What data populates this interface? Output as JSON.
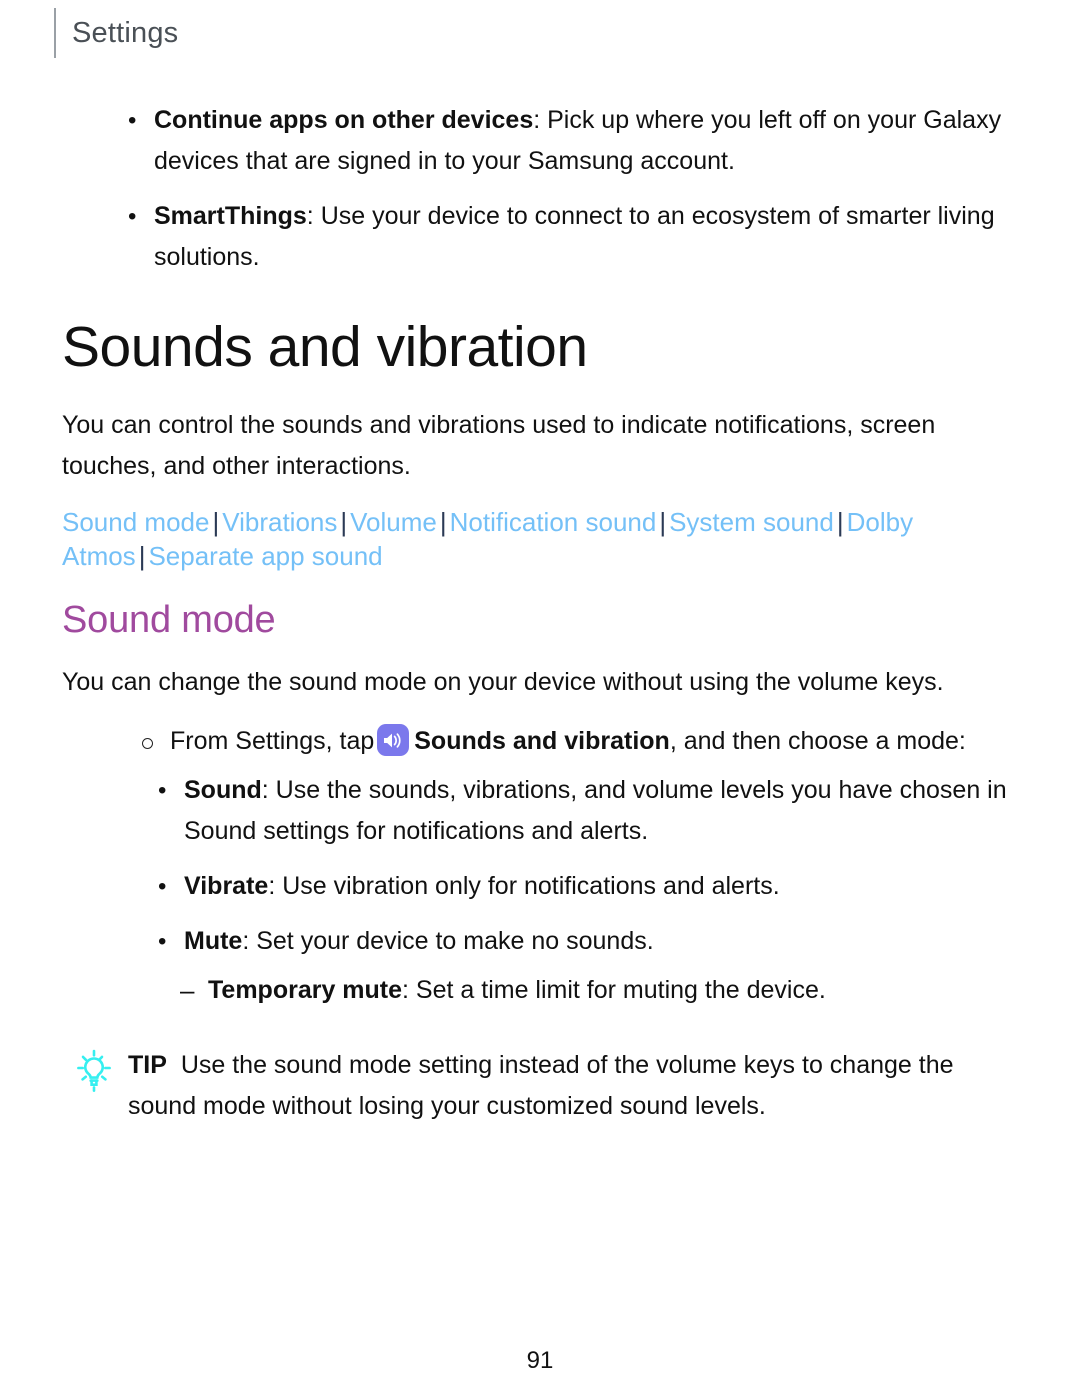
{
  "header": {
    "title": "Settings"
  },
  "intro_bullets": [
    {
      "marker": "dot",
      "bold": "Continue apps on other devices",
      "rest": ": Pick up where you left off on your Galaxy devices that are signed in to your Samsung account."
    },
    {
      "marker": "dot",
      "bold": "SmartThings",
      "rest": ": Use your device to connect to an ecosystem of smarter living solutions."
    }
  ],
  "section": {
    "heading": "Sounds and vibration",
    "intro": "You can control the sounds and vibrations used to indicate notifications, screen touches, and other interactions."
  },
  "linkbar": {
    "separator": "|",
    "links": [
      "Sound mode",
      "Vibrations",
      "Volume",
      "Notification sound",
      "System sound",
      "Dolby Atmos",
      "Separate app sound"
    ]
  },
  "sound_mode": {
    "heading": "Sound mode",
    "intro": "You can change the sound mode on your device without using the volume keys.",
    "step": {
      "before_icon": "From Settings, tap",
      "icon_name": "sounds-and-vibration-icon",
      "bold": "Sounds and vibration",
      "after": ", and then choose a mode:"
    },
    "modes": [
      {
        "marker": "dot",
        "bold": "Sound",
        "rest": ": Use the sounds, vibrations, and volume levels you have chosen in Sound settings for notifications and alerts."
      },
      {
        "marker": "dot",
        "bold": "Vibrate",
        "rest": ": Use vibration only for notifications and alerts."
      },
      {
        "marker": "dot",
        "bold": "Mute",
        "rest": ": Set your device to make no sounds."
      },
      {
        "marker": "dash",
        "bold": "Temporary mute",
        "rest": ": Set a time limit for muting the device."
      }
    ]
  },
  "tip": {
    "label": "TIP",
    "text": "Use the sound mode setting instead of the volume keys to change the sound mode without losing your customized sound levels."
  },
  "footer": {
    "page_number": "91"
  },
  "colors": {
    "link": "#74c0f7",
    "separator": "#2b3a55",
    "sub_heading": "#a04a9e",
    "app_icon": "#7b78ec",
    "tip_icon": "#35eff0",
    "header_title": "#4a5056"
  }
}
